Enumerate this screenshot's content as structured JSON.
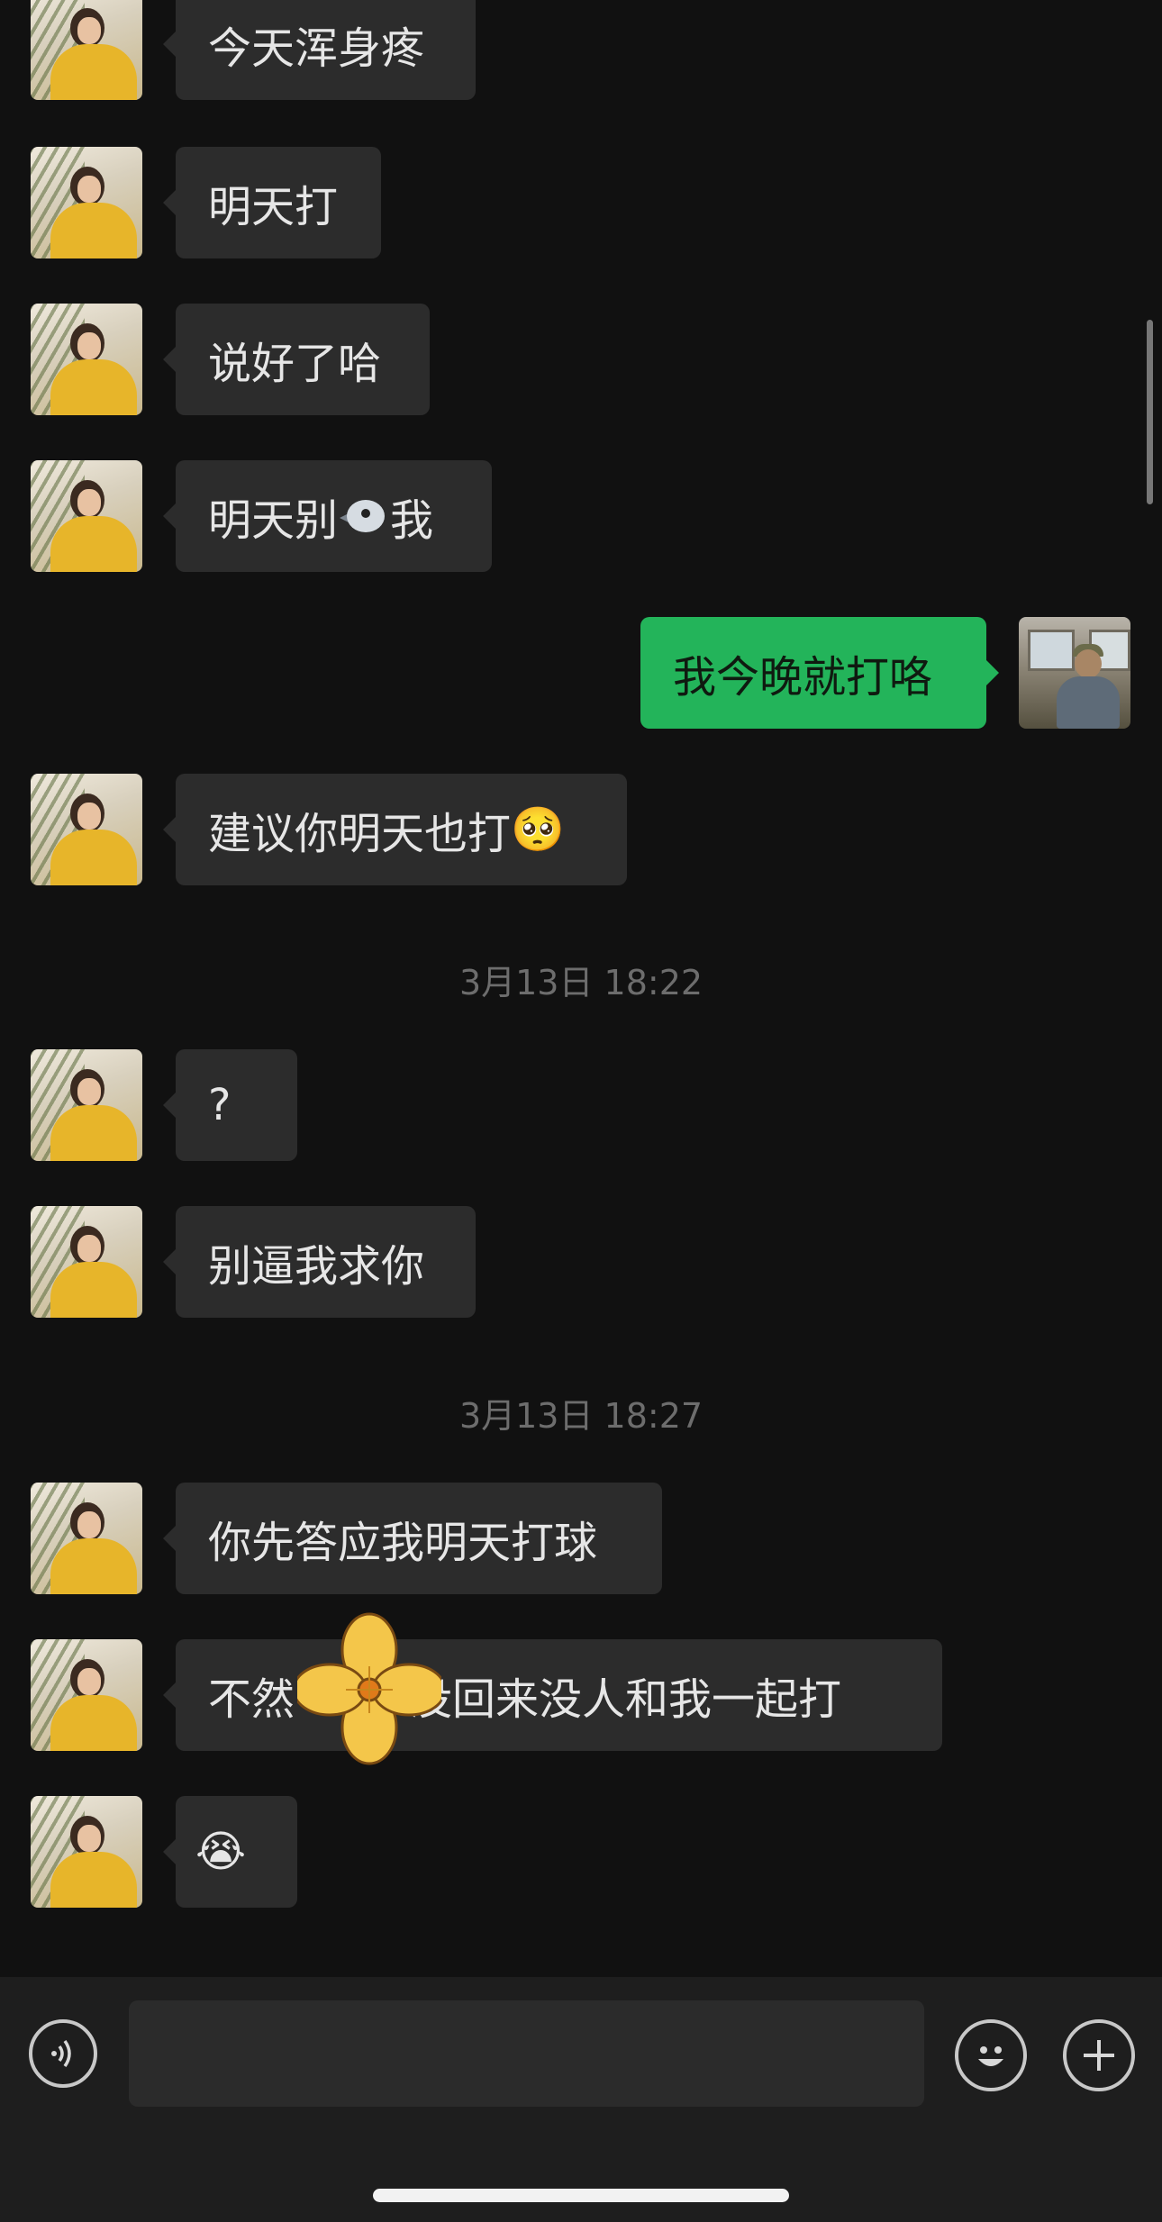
{
  "colors": {
    "background": "#111111",
    "incoming_bubble": "#2c2c2c",
    "outgoing_bubble": "#23b45a",
    "timestamp_text": "#6d6d6d",
    "input_bar": "#1e1e1e"
  },
  "messages": [
    {
      "direction": "in",
      "text": "今天浑身疼"
    },
    {
      "direction": "in",
      "text": "明天打"
    },
    {
      "direction": "in",
      "text": "说好了哈"
    },
    {
      "direction": "in",
      "text_before": "明天别",
      "icon": "bird-emoji-icon",
      "text_after": "我"
    },
    {
      "direction": "out",
      "text": "我今晚就打咯"
    },
    {
      "direction": "in",
      "text": "建议你明天也打",
      "emoji": "🥺"
    },
    {
      "type": "timestamp",
      "text": "3月13日 18:22"
    },
    {
      "direction": "in",
      "text": "?"
    },
    {
      "direction": "in",
      "text": "别逼我求你"
    },
    {
      "type": "timestamp",
      "text": "3月13日 18:27"
    },
    {
      "direction": "in",
      "text": "你先答应我明天打球"
    },
    {
      "direction": "in",
      "text_before": "不然",
      "text_after": "没回来没人和我一起打",
      "sticker": "flower-sticker"
    },
    {
      "direction": "in",
      "emoji": "😭"
    }
  ],
  "input_bar": {
    "voice_icon": "voice-icon",
    "emoji_icon": "smiley-icon",
    "plus_icon": "plus-icon",
    "placeholder": ""
  }
}
